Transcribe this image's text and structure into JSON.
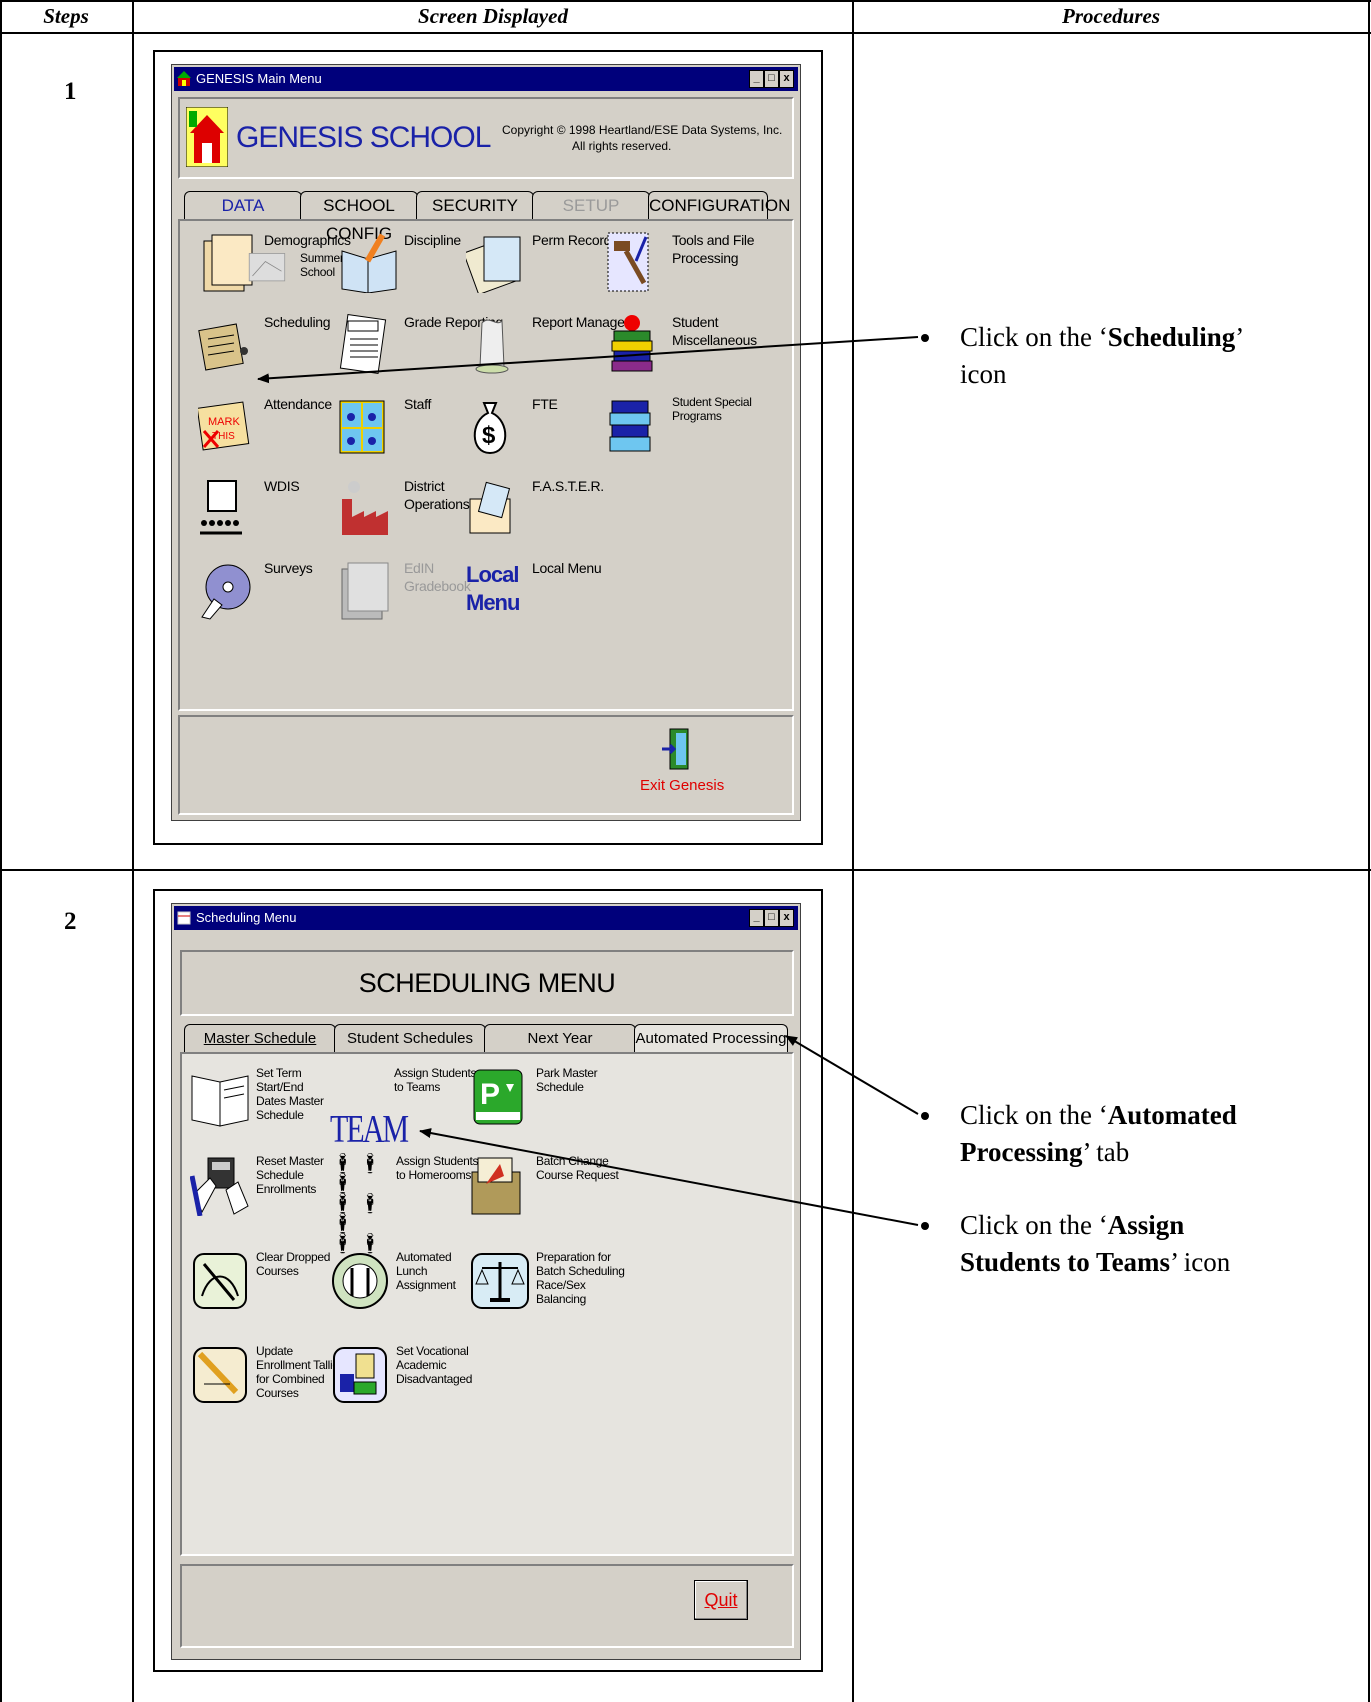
{
  "table": {
    "col_steps": "Steps",
    "col_screen": "Screen Displayed",
    "col_procedures": "Procedures"
  },
  "step1": {
    "number": "1",
    "window_title": "GENESIS Main Menu",
    "app_name": "GENESIS SCHOOL",
    "copyright_line1": "Copyright © 1998 Heartland/ESE Data Systems, Inc.",
    "copyright_line2": "All rights reserved.",
    "tabs": [
      "DATA",
      "SCHOOL CONFIG",
      "SECURITY",
      "SETUP",
      "CONFIGURATION"
    ],
    "icons": {
      "demographics": "Demographics",
      "summer_school_1": "Summer",
      "summer_school_2": "School",
      "discipline": "Discipline",
      "perm_records": "Perm Records",
      "tools_1": "Tools and File",
      "tools_2": "Processing",
      "scheduling": "Scheduling",
      "grade_reporting": "Grade Reporting",
      "report_manager": "Report Manager",
      "student_misc_1": "Student",
      "student_misc_2": "Miscellaneous",
      "attendance": "Attendance",
      "staff": "Staff",
      "fte": "FTE",
      "special_1": "Student Special",
      "special_2": "Programs",
      "wdis": "WDIS",
      "district_1": "District",
      "district_2": "Operations",
      "faster": "F.A.S.T.E.R.",
      "surveys": "Surveys",
      "edin_1": "EdIN",
      "edin_2": "Gradebook",
      "local_menu": "Local Menu",
      "local_icon_1": "Local",
      "local_icon_2": "Menu"
    },
    "exit_label": "Exit Genesis",
    "procedure_pre": "Click on the ‘",
    "procedure_bold": "Scheduling",
    "procedure_post": "’",
    "procedure_line2": "icon"
  },
  "step2": {
    "number": "2",
    "window_title": "Scheduling Menu",
    "menu_title": "SCHEDULING MENU",
    "tabs": [
      "Master Schedule",
      "Student Schedules",
      "Next Year",
      "Automated Processing"
    ],
    "icons": {
      "set_term_1": "Set Term",
      "set_term_2": "Start/End",
      "set_term_3": "Dates Master",
      "set_term_4": "Schedule",
      "team_text": "TEAM",
      "assign_teams_1": "Assign Students",
      "assign_teams_2": "to Teams",
      "park_1": "Park Master",
      "park_2": "Schedule",
      "reset_1": "Reset Master",
      "reset_2": "Schedule",
      "reset_3": "Enrollments",
      "homerooms_1": "Assign Students",
      "homerooms_2": "to Homerooms",
      "batch_change_1": "Batch Change",
      "batch_change_2": "Course Request",
      "clear_1": "Clear Dropped",
      "clear_2": "Courses",
      "lunch_1": "Automated",
      "lunch_2": "Lunch",
      "lunch_3": "Assignment",
      "prep_1": "Preparation for",
      "prep_2": "Batch Scheduling",
      "prep_3": "Race/Sex",
      "prep_4": "Balancing",
      "update_1": "Update",
      "update_2": "Enrollment Tallies",
      "update_3": "for Combined",
      "update_4": "Courses",
      "voc_1": "Set Vocational",
      "voc_2": "Academic",
      "voc_3": "Disadvantaged"
    },
    "quit_label": "Quit",
    "proc1_pre": "Click on the ‘",
    "proc1_bold_1": "Automated",
    "proc1_bold_2": "Processing",
    "proc1_post": "’ tab",
    "proc2_pre": "Click on the ‘",
    "proc2_bold_1": "Assign",
    "proc2_bold_2": "Students to Teams",
    "proc2_post": "’ icon"
  },
  "colors": {
    "titlebar": "#00007b",
    "window_bg": "#d4d0c8",
    "exit_red": "#e00000",
    "team_blue": "#1a22a8"
  }
}
